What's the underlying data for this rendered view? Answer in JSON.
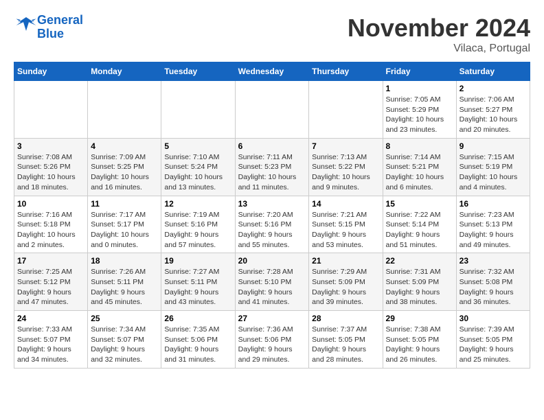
{
  "header": {
    "logo_line1": "General",
    "logo_line2": "Blue",
    "month": "November 2024",
    "location": "Vilaca, Portugal"
  },
  "weekdays": [
    "Sunday",
    "Monday",
    "Tuesday",
    "Wednesday",
    "Thursday",
    "Friday",
    "Saturday"
  ],
  "weeks": [
    [
      {
        "day": "",
        "info": ""
      },
      {
        "day": "",
        "info": ""
      },
      {
        "day": "",
        "info": ""
      },
      {
        "day": "",
        "info": ""
      },
      {
        "day": "",
        "info": ""
      },
      {
        "day": "1",
        "info": "Sunrise: 7:05 AM\nSunset: 5:29 PM\nDaylight: 10 hours and 23 minutes."
      },
      {
        "day": "2",
        "info": "Sunrise: 7:06 AM\nSunset: 5:27 PM\nDaylight: 10 hours and 20 minutes."
      }
    ],
    [
      {
        "day": "3",
        "info": "Sunrise: 7:08 AM\nSunset: 5:26 PM\nDaylight: 10 hours and 18 minutes."
      },
      {
        "day": "4",
        "info": "Sunrise: 7:09 AM\nSunset: 5:25 PM\nDaylight: 10 hours and 16 minutes."
      },
      {
        "day": "5",
        "info": "Sunrise: 7:10 AM\nSunset: 5:24 PM\nDaylight: 10 hours and 13 minutes."
      },
      {
        "day": "6",
        "info": "Sunrise: 7:11 AM\nSunset: 5:23 PM\nDaylight: 10 hours and 11 minutes."
      },
      {
        "day": "7",
        "info": "Sunrise: 7:13 AM\nSunset: 5:22 PM\nDaylight: 10 hours and 9 minutes."
      },
      {
        "day": "8",
        "info": "Sunrise: 7:14 AM\nSunset: 5:21 PM\nDaylight: 10 hours and 6 minutes."
      },
      {
        "day": "9",
        "info": "Sunrise: 7:15 AM\nSunset: 5:19 PM\nDaylight: 10 hours and 4 minutes."
      }
    ],
    [
      {
        "day": "10",
        "info": "Sunrise: 7:16 AM\nSunset: 5:18 PM\nDaylight: 10 hours and 2 minutes."
      },
      {
        "day": "11",
        "info": "Sunrise: 7:17 AM\nSunset: 5:17 PM\nDaylight: 10 hours and 0 minutes."
      },
      {
        "day": "12",
        "info": "Sunrise: 7:19 AM\nSunset: 5:16 PM\nDaylight: 9 hours and 57 minutes."
      },
      {
        "day": "13",
        "info": "Sunrise: 7:20 AM\nSunset: 5:16 PM\nDaylight: 9 hours and 55 minutes."
      },
      {
        "day": "14",
        "info": "Sunrise: 7:21 AM\nSunset: 5:15 PM\nDaylight: 9 hours and 53 minutes."
      },
      {
        "day": "15",
        "info": "Sunrise: 7:22 AM\nSunset: 5:14 PM\nDaylight: 9 hours and 51 minutes."
      },
      {
        "day": "16",
        "info": "Sunrise: 7:23 AM\nSunset: 5:13 PM\nDaylight: 9 hours and 49 minutes."
      }
    ],
    [
      {
        "day": "17",
        "info": "Sunrise: 7:25 AM\nSunset: 5:12 PM\nDaylight: 9 hours and 47 minutes."
      },
      {
        "day": "18",
        "info": "Sunrise: 7:26 AM\nSunset: 5:11 PM\nDaylight: 9 hours and 45 minutes."
      },
      {
        "day": "19",
        "info": "Sunrise: 7:27 AM\nSunset: 5:11 PM\nDaylight: 9 hours and 43 minutes."
      },
      {
        "day": "20",
        "info": "Sunrise: 7:28 AM\nSunset: 5:10 PM\nDaylight: 9 hours and 41 minutes."
      },
      {
        "day": "21",
        "info": "Sunrise: 7:29 AM\nSunset: 5:09 PM\nDaylight: 9 hours and 39 minutes."
      },
      {
        "day": "22",
        "info": "Sunrise: 7:31 AM\nSunset: 5:09 PM\nDaylight: 9 hours and 38 minutes."
      },
      {
        "day": "23",
        "info": "Sunrise: 7:32 AM\nSunset: 5:08 PM\nDaylight: 9 hours and 36 minutes."
      }
    ],
    [
      {
        "day": "24",
        "info": "Sunrise: 7:33 AM\nSunset: 5:07 PM\nDaylight: 9 hours and 34 minutes."
      },
      {
        "day": "25",
        "info": "Sunrise: 7:34 AM\nSunset: 5:07 PM\nDaylight: 9 hours and 32 minutes."
      },
      {
        "day": "26",
        "info": "Sunrise: 7:35 AM\nSunset: 5:06 PM\nDaylight: 9 hours and 31 minutes."
      },
      {
        "day": "27",
        "info": "Sunrise: 7:36 AM\nSunset: 5:06 PM\nDaylight: 9 hours and 29 minutes."
      },
      {
        "day": "28",
        "info": "Sunrise: 7:37 AM\nSunset: 5:05 PM\nDaylight: 9 hours and 28 minutes."
      },
      {
        "day": "29",
        "info": "Sunrise: 7:38 AM\nSunset: 5:05 PM\nDaylight: 9 hours and 26 minutes."
      },
      {
        "day": "30",
        "info": "Sunrise: 7:39 AM\nSunset: 5:05 PM\nDaylight: 9 hours and 25 minutes."
      }
    ]
  ]
}
